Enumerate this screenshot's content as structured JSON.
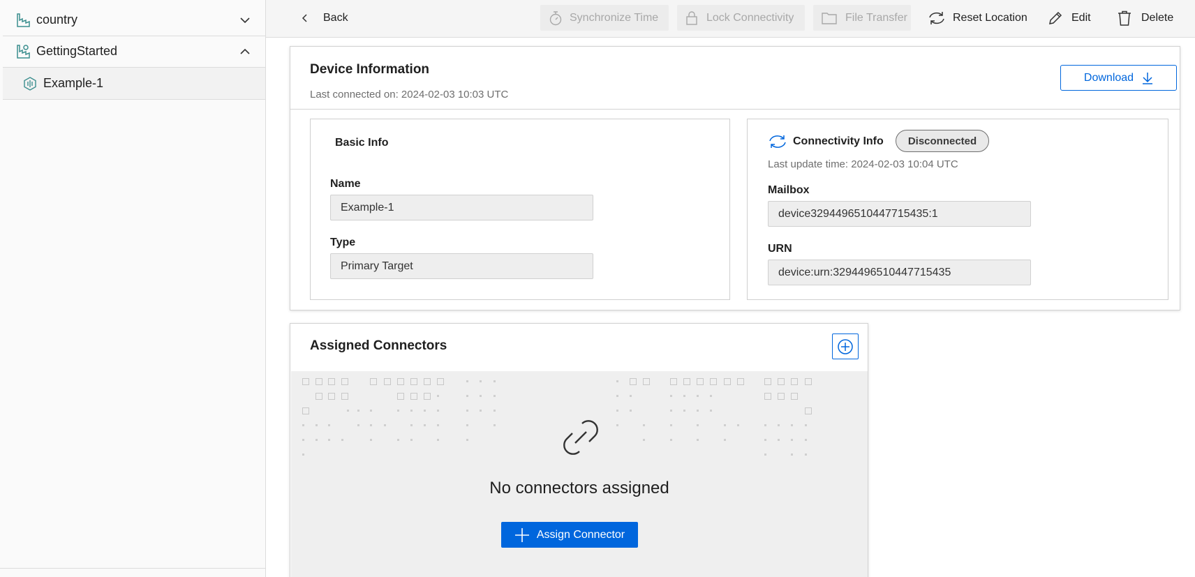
{
  "sidebar": {
    "items": [
      {
        "label": "country",
        "icon": "plant-icon",
        "expanded": false
      },
      {
        "label": "GettingStarted",
        "icon": "plant-building-icon",
        "expanded": true
      },
      {
        "label": "Example-1",
        "icon": "device-icon"
      }
    ]
  },
  "toolbar": {
    "back_label": "Back",
    "sync_time_label": "Synchronize Time",
    "lock_connectivity_label": "Lock Connectivity",
    "file_transfer_label": "File Transfer",
    "reset_location_label": "Reset Location",
    "edit_label": "Edit",
    "delete_label": "Delete"
  },
  "device_info": {
    "title": "Device Information",
    "last_connected": "Last connected on: 2024-02-03 10:03 UTC",
    "download_label": "Download",
    "basic_info": {
      "title": "Basic Info",
      "name_label": "Name",
      "name_value": "Example-1",
      "type_label": "Type",
      "type_value": "Primary Target"
    },
    "connectivity": {
      "title": "Connectivity Info",
      "status": "Disconnected",
      "last_update": "Last update time: 2024-02-03 10:04 UTC",
      "mailbox_label": "Mailbox",
      "mailbox_value": "device3294496510447715435:1",
      "urn_label": "URN",
      "urn_value": "device:urn:3294496510447715435"
    }
  },
  "connectors": {
    "title": "Assigned Connectors",
    "empty_message": "No connectors assigned",
    "assign_label": "Assign Connector"
  },
  "colors": {
    "accent": "#0066dd",
    "disabled_text": "#a8a8a8",
    "field_bg": "#eeeeee",
    "empty_bg": "#efefef"
  }
}
